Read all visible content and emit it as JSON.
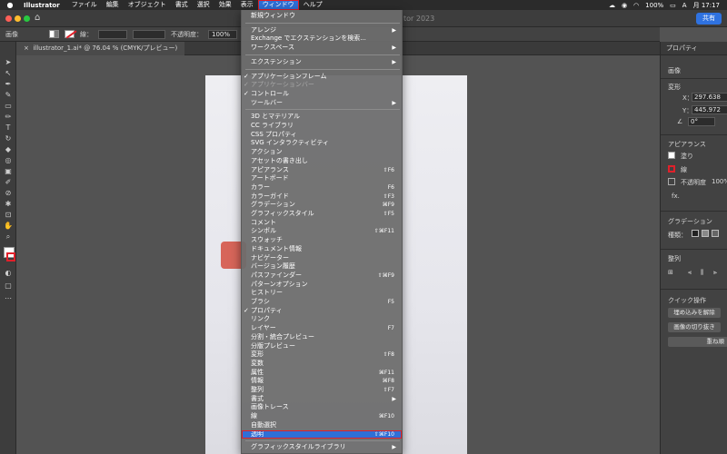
{
  "menubar": {
    "app_name": "Illustrator",
    "items": [
      "ファイル",
      "編集",
      "オブジェクト",
      "書式",
      "選択",
      "効果",
      "表示",
      "ウィンドウ",
      "ヘルプ"
    ],
    "battery": "100%",
    "time": "月 17:17"
  },
  "window": {
    "title": "tor 2023",
    "share_label": "共有"
  },
  "controlbar": {
    "object_label": "画像",
    "stroke_label": "線：",
    "opacity_label": "不透明度：",
    "opacity_value": "100%"
  },
  "document_tab": {
    "label": "illustrator_1.ai* @ 76.04 % (CMYK/プレビュー)"
  },
  "right_panel": {
    "tab_label": "プロパティ",
    "object_type": "画像",
    "transform_heading": "変形",
    "x_label": "X：",
    "x_value": "297.638",
    "y_label": "Y：",
    "y_value": "445.972",
    "angle_value": "0°",
    "appearance_heading": "アピアランス",
    "fill_label": "塗り",
    "stroke_label": "線",
    "opacity_label": "不透明度",
    "opacity_value": "100%",
    "fx_label": "fx.",
    "gradation_heading": "グラデーション",
    "gradation_type_label": "種類：",
    "align_heading": "整列",
    "quick_actions_heading": "クイック操作",
    "quick_btn_1": "埋め込みを解除",
    "quick_btn_2": "画像の切り抜き",
    "quick_btn_3": "重ね順"
  },
  "menu": {
    "items": [
      {
        "label": "新規ウィンドウ",
        "shortcut": "",
        "submenu": false,
        "checked": false,
        "disabled": false,
        "highlighted": false
      },
      {
        "label": "アレンジ",
        "shortcut": "",
        "submenu": true,
        "checked": false,
        "disabled": false,
        "highlighted": false
      },
      {
        "label": "Exchange でエクステンションを検索...",
        "shortcut": "",
        "submenu": false,
        "checked": false,
        "disabled": false,
        "highlighted": false
      },
      {
        "label": "ワークスペース",
        "shortcut": "",
        "submenu": true,
        "checked": false,
        "disabled": false,
        "highlighted": false
      },
      {
        "label": "エクステンション",
        "shortcut": "",
        "submenu": true,
        "checked": false,
        "disabled": false,
        "highlighted": false
      },
      {
        "label": "アプリケーションフレーム",
        "shortcut": "",
        "submenu": false,
        "checked": true,
        "disabled": false,
        "highlighted": false
      },
      {
        "label": "アプリケーションバー",
        "shortcut": "",
        "submenu": false,
        "checked": true,
        "disabled": true,
        "highlighted": false
      },
      {
        "label": "コントロール",
        "shortcut": "",
        "submenu": false,
        "checked": true,
        "disabled": false,
        "highlighted": false
      },
      {
        "label": "ツールバー",
        "shortcut": "",
        "submenu": true,
        "checked": false,
        "disabled": false,
        "highlighted": false
      },
      {
        "label": "3D とマテリアル",
        "shortcut": "",
        "submenu": false,
        "checked": false,
        "disabled": false,
        "highlighted": false
      },
      {
        "label": "CC ライブラリ",
        "shortcut": "",
        "submenu": false,
        "checked": false,
        "disabled": false,
        "highlighted": false
      },
      {
        "label": "CSS プロパティ",
        "shortcut": "",
        "submenu": false,
        "checked": false,
        "disabled": false,
        "highlighted": false
      },
      {
        "label": "SVG インタラクティビティ",
        "shortcut": "",
        "submenu": false,
        "checked": false,
        "disabled": false,
        "highlighted": false
      },
      {
        "label": "アクション",
        "shortcut": "",
        "submenu": false,
        "checked": false,
        "disabled": false,
        "highlighted": false
      },
      {
        "label": "アセットの書き出し",
        "shortcut": "",
        "submenu": false,
        "checked": false,
        "disabled": false,
        "highlighted": false
      },
      {
        "label": "アピアランス",
        "shortcut": "⇧F6",
        "submenu": false,
        "checked": false,
        "disabled": false,
        "highlighted": false
      },
      {
        "label": "アートボード",
        "shortcut": "",
        "submenu": false,
        "checked": false,
        "disabled": false,
        "highlighted": false
      },
      {
        "label": "カラー",
        "shortcut": "F6",
        "submenu": false,
        "checked": false,
        "disabled": false,
        "highlighted": false
      },
      {
        "label": "カラーガイド",
        "shortcut": "⇧F3",
        "submenu": false,
        "checked": false,
        "disabled": false,
        "highlighted": false
      },
      {
        "label": "グラデーション",
        "shortcut": "⌘F9",
        "submenu": false,
        "checked": false,
        "disabled": false,
        "highlighted": false
      },
      {
        "label": "グラフィックスタイル",
        "shortcut": "⇧F5",
        "submenu": false,
        "checked": false,
        "disabled": false,
        "highlighted": false
      },
      {
        "label": "コメント",
        "shortcut": "",
        "submenu": false,
        "checked": false,
        "disabled": false,
        "highlighted": false
      },
      {
        "label": "シンボル",
        "shortcut": "⇧⌘F11",
        "submenu": false,
        "checked": false,
        "disabled": false,
        "highlighted": false
      },
      {
        "label": "スウォッチ",
        "shortcut": "",
        "submenu": false,
        "checked": false,
        "disabled": false,
        "highlighted": false
      },
      {
        "label": "ドキュメント情報",
        "shortcut": "",
        "submenu": false,
        "checked": false,
        "disabled": false,
        "highlighted": false
      },
      {
        "label": "ナビゲーター",
        "shortcut": "",
        "submenu": false,
        "checked": false,
        "disabled": false,
        "highlighted": false
      },
      {
        "label": "バージョン履歴",
        "shortcut": "",
        "submenu": false,
        "checked": false,
        "disabled": false,
        "highlighted": false
      },
      {
        "label": "パスファインダー",
        "shortcut": "⇧⌘F9",
        "submenu": false,
        "checked": false,
        "disabled": false,
        "highlighted": false
      },
      {
        "label": "パターンオプション",
        "shortcut": "",
        "submenu": false,
        "checked": false,
        "disabled": false,
        "highlighted": false
      },
      {
        "label": "ヒストリー",
        "shortcut": "",
        "submenu": false,
        "checked": false,
        "disabled": false,
        "highlighted": false
      },
      {
        "label": "ブラシ",
        "shortcut": "F5",
        "submenu": false,
        "checked": false,
        "disabled": false,
        "highlighted": false
      },
      {
        "label": "プロパティ",
        "shortcut": "",
        "submenu": false,
        "checked": true,
        "disabled": false,
        "highlighted": false
      },
      {
        "label": "リンク",
        "shortcut": "",
        "submenu": false,
        "checked": false,
        "disabled": false,
        "highlighted": false
      },
      {
        "label": "レイヤー",
        "shortcut": "F7",
        "submenu": false,
        "checked": false,
        "disabled": false,
        "highlighted": false
      },
      {
        "label": "分割・統合プレビュー",
        "shortcut": "",
        "submenu": false,
        "checked": false,
        "disabled": false,
        "highlighted": false
      },
      {
        "label": "分版プレビュー",
        "shortcut": "",
        "submenu": false,
        "checked": false,
        "disabled": false,
        "highlighted": false
      },
      {
        "label": "変形",
        "shortcut": "⇧F8",
        "submenu": false,
        "checked": false,
        "disabled": false,
        "highlighted": false
      },
      {
        "label": "変数",
        "shortcut": "",
        "submenu": false,
        "checked": false,
        "disabled": false,
        "highlighted": false
      },
      {
        "label": "属性",
        "shortcut": "⌘F11",
        "submenu": false,
        "checked": false,
        "disabled": false,
        "highlighted": false
      },
      {
        "label": "情報",
        "shortcut": "⌘F8",
        "submenu": false,
        "checked": false,
        "disabled": false,
        "highlighted": false
      },
      {
        "label": "整列",
        "shortcut": "⇧F7",
        "submenu": false,
        "checked": false,
        "disabled": false,
        "highlighted": false
      },
      {
        "label": "書式",
        "shortcut": "",
        "submenu": true,
        "checked": false,
        "disabled": false,
        "highlighted": false
      },
      {
        "label": "画像トレース",
        "shortcut": "",
        "submenu": false,
        "checked": false,
        "disabled": false,
        "highlighted": false
      },
      {
        "label": "線",
        "shortcut": "⌘F10",
        "submenu": false,
        "checked": false,
        "disabled": false,
        "highlighted": false
      },
      {
        "label": "自動選択",
        "shortcut": "",
        "submenu": false,
        "checked": false,
        "disabled": false,
        "highlighted": false
      },
      {
        "label": "透明",
        "shortcut": "⇧⌘F10",
        "submenu": false,
        "checked": false,
        "disabled": false,
        "highlighted": true
      },
      {
        "label": "グラフィックスタイルライブラリ",
        "shortcut": "",
        "submenu": true,
        "checked": false,
        "disabled": false,
        "highlighted": false
      }
    ]
  },
  "colors": {
    "accent_blue": "#2f6fd6",
    "highlight_red": "#e0202a",
    "share_button": "#2f72e0"
  },
  "icons": {
    "apple": "apple-icon",
    "home": "home-icon",
    "wifi": "wifi-icon",
    "battery": "battery-icon",
    "search": "search-icon"
  }
}
